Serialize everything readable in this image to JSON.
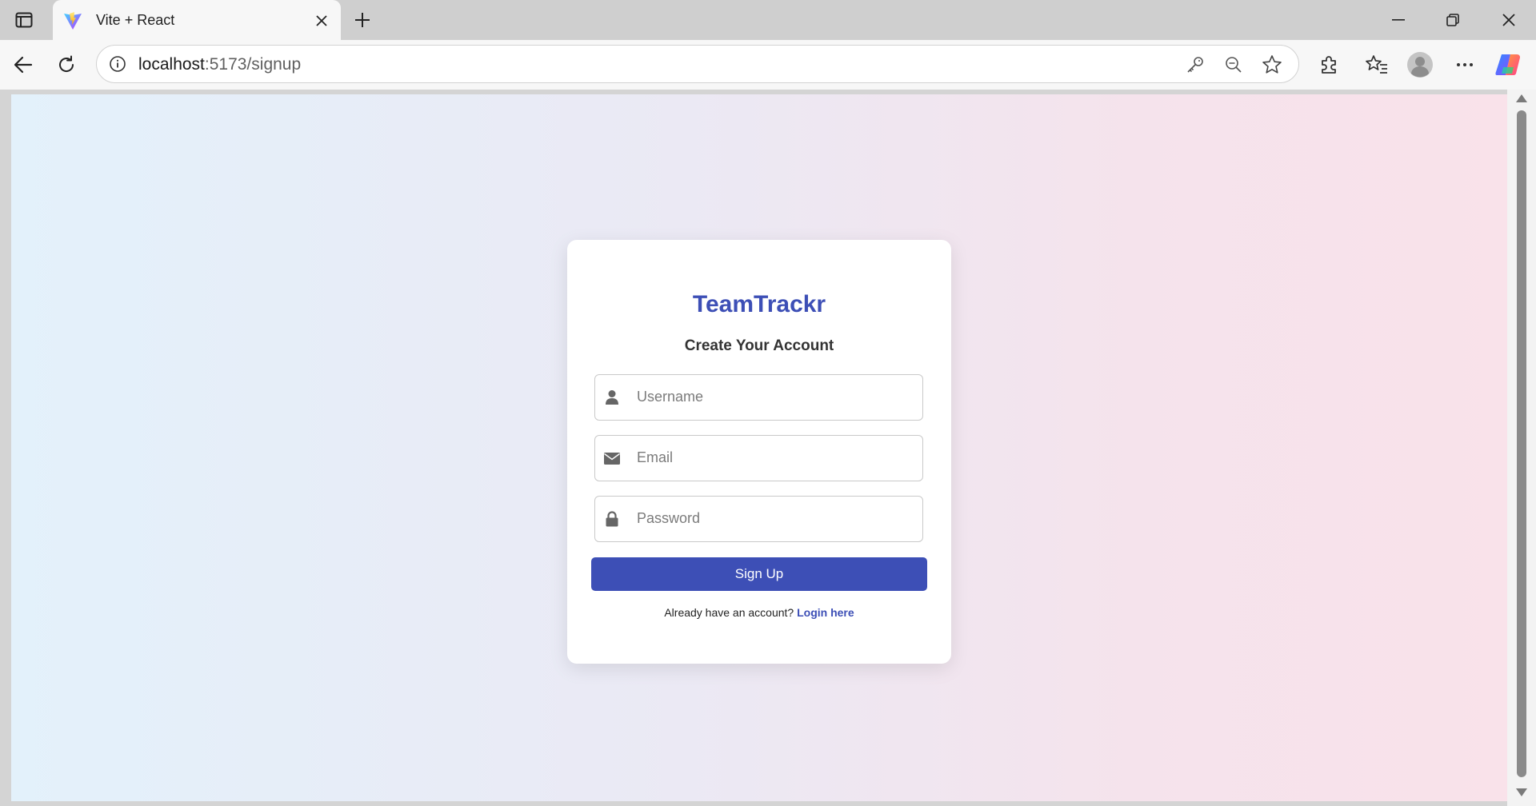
{
  "browser": {
    "tab_title": "Vite + React",
    "url_host": "localhost",
    "url_path": ":5173/signup"
  },
  "signup": {
    "brand": "TeamTrackr",
    "subtitle": "Create Your Account",
    "username_placeholder": "Username",
    "email_placeholder": "Email",
    "password_placeholder": "Password",
    "submit_label": "Sign Up",
    "footer_prompt": "Already have an account?",
    "login_link": "Login here"
  },
  "colors": {
    "accent": "#3d4fb6",
    "bg_left": "#e3f1fb",
    "bg_right": "#f9e2ea"
  },
  "icons": [
    "sidebar-icon",
    "vite-icon",
    "close-icon",
    "plus-icon",
    "minimize-icon",
    "restore-icon",
    "back-icon",
    "refresh-icon",
    "info-icon",
    "key-icon",
    "zoom-out-icon",
    "star-icon",
    "extensions-icon",
    "favorites-icon",
    "profile-icon",
    "more-icon",
    "copilot-icon",
    "user-icon",
    "envelope-icon",
    "lock-icon"
  ]
}
